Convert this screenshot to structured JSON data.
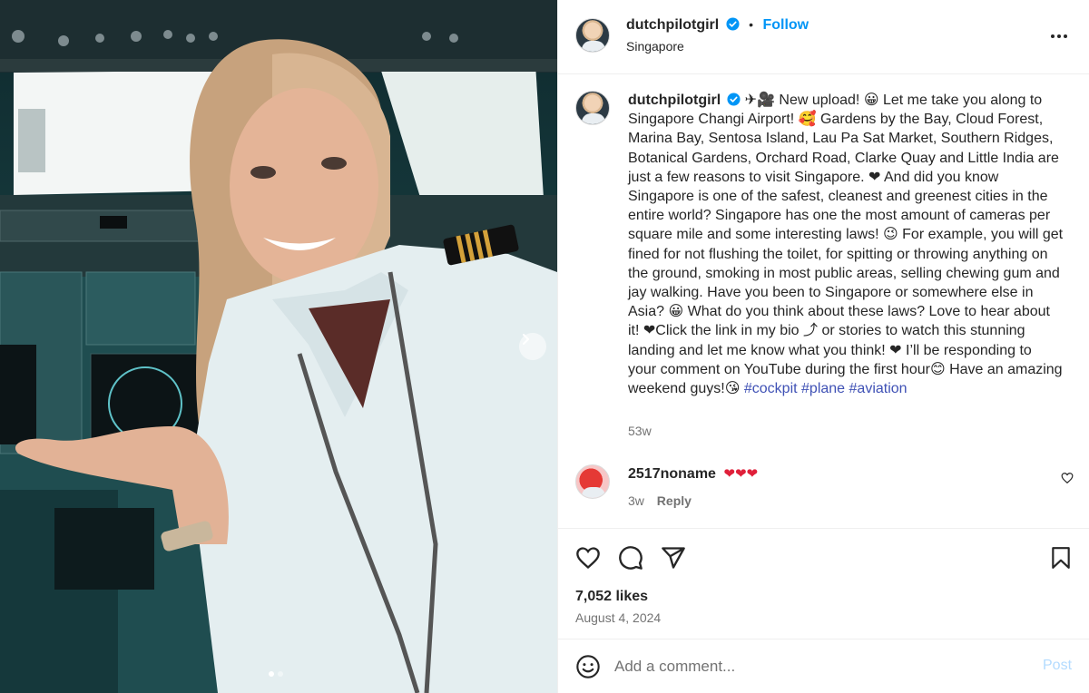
{
  "post": {
    "username": "dutchpilotgirl",
    "follow_label": "Follow",
    "separator": "•",
    "location": "Singapore",
    "caption_part1": "✈🎥 New upload! 😀 Let me take you along to Singapore Changi Airport! 🥰 Gardens by the Bay, Cloud Forest, Marina Bay, Sentosa Island, Lau Pa Sat Market, Southern Ridges, Botanical Gardens, Orchard Road, Clarke Quay and Little India are just a few reasons to visit Singapore. ❤ And did you know Singapore is one of the safest, cleanest and greenest cities in the entire world? Singapore has one the most amount of cameras per square mile and some interesting laws! 😉 For example, you will get fined for not flushing the toilet, for spitting or throwing anything on the ground, smoking in most public areas, selling chewing gum and jay walking. Have you been to Singapore or somewhere else in Asia? 😀 What do you think about these laws? Love to hear about it! ❤Click the link in my bio ⤴ or stories to watch this stunning landing and let me know what you think! ❤ I’ll be responding to your comment on YouTube during the first hour😊 Have an amazing weekend guys!😘",
    "hashtags": [
      "#cockpit",
      "#plane",
      "#aviation"
    ],
    "caption_age": "53w",
    "likes": "7,052 likes",
    "date": "August 4, 2024"
  },
  "comments": [
    {
      "username": "2517noname",
      "text": "❤❤❤",
      "age": "3w",
      "reply_label": "Reply"
    }
  ],
  "composer": {
    "placeholder": "Add a comment...",
    "post_label": "Post"
  },
  "carousel": {
    "slides": 2,
    "current": 1
  },
  "icons": {
    "more": "more-options-icon",
    "verified": "verified-badge-icon",
    "like": "heart-icon",
    "comment": "comment-icon",
    "share": "share-icon",
    "save": "bookmark-icon",
    "emoji": "emoji-icon",
    "next": "chevron-right-icon"
  },
  "colors": {
    "accent": "#0095f6",
    "hashtag": "#3f51b5",
    "muted": "#737373",
    "heart": "#ed4956"
  }
}
